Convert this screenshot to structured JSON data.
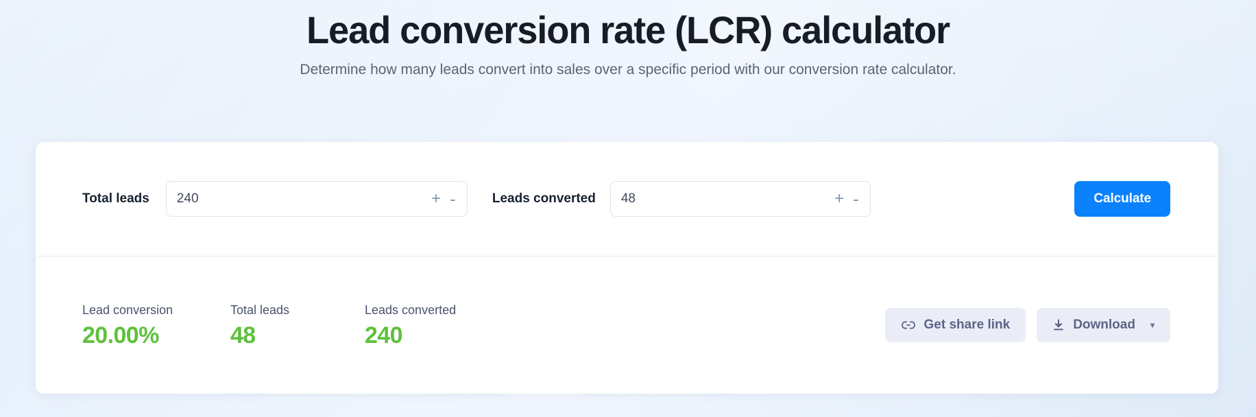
{
  "header": {
    "title": "Lead conversion rate (LCR) calculator",
    "subtitle": "Determine how many leads convert into sales over a specific period with our conversion rate calculator."
  },
  "form": {
    "total_leads": {
      "label": "Total leads",
      "value": "240",
      "placeholder": "",
      "increment_label": "+",
      "decrement_label": "-"
    },
    "leads_converted": {
      "label": "Leads converted",
      "value": "48",
      "placeholder": "",
      "increment_label": "+",
      "decrement_label": "-"
    },
    "calculate_label": "Calculate"
  },
  "results": {
    "items": [
      {
        "label": "Lead conversion",
        "value": "20.00%"
      },
      {
        "label": "Total leads",
        "value": "48"
      },
      {
        "label": "Leads converted",
        "value": "240"
      }
    ],
    "value_color": "#5ec13c"
  },
  "actions": {
    "share_label": "Get share link",
    "download_label": "Download",
    "download_caret": "▾"
  },
  "colors": {
    "accent_blue": "#0b82fb",
    "result_green": "#5ec13c",
    "page_background": "#e9f1fb",
    "button_gray": "#eaedf6"
  }
}
